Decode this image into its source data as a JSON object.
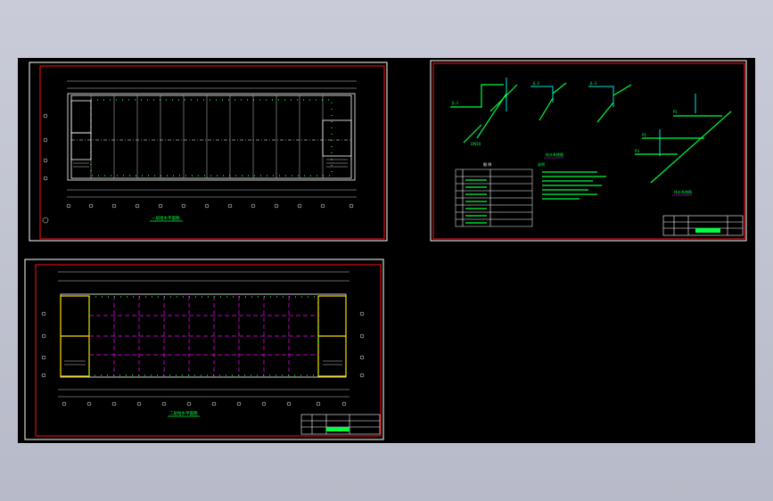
{
  "viewport": {
    "background": "#000000",
    "border_color": "#ff1010",
    "accent": "#00ff40"
  },
  "sheet_plan_1": {
    "title_label": "一层给水平面图"
  },
  "sheet_plan_2": {
    "title_label": "二层给水平面图"
  },
  "sheet_system": {
    "legend_title": "图 例",
    "notes_title": "说明",
    "system_label_1": "给水系统图",
    "system_label_2": "排水系统图"
  }
}
